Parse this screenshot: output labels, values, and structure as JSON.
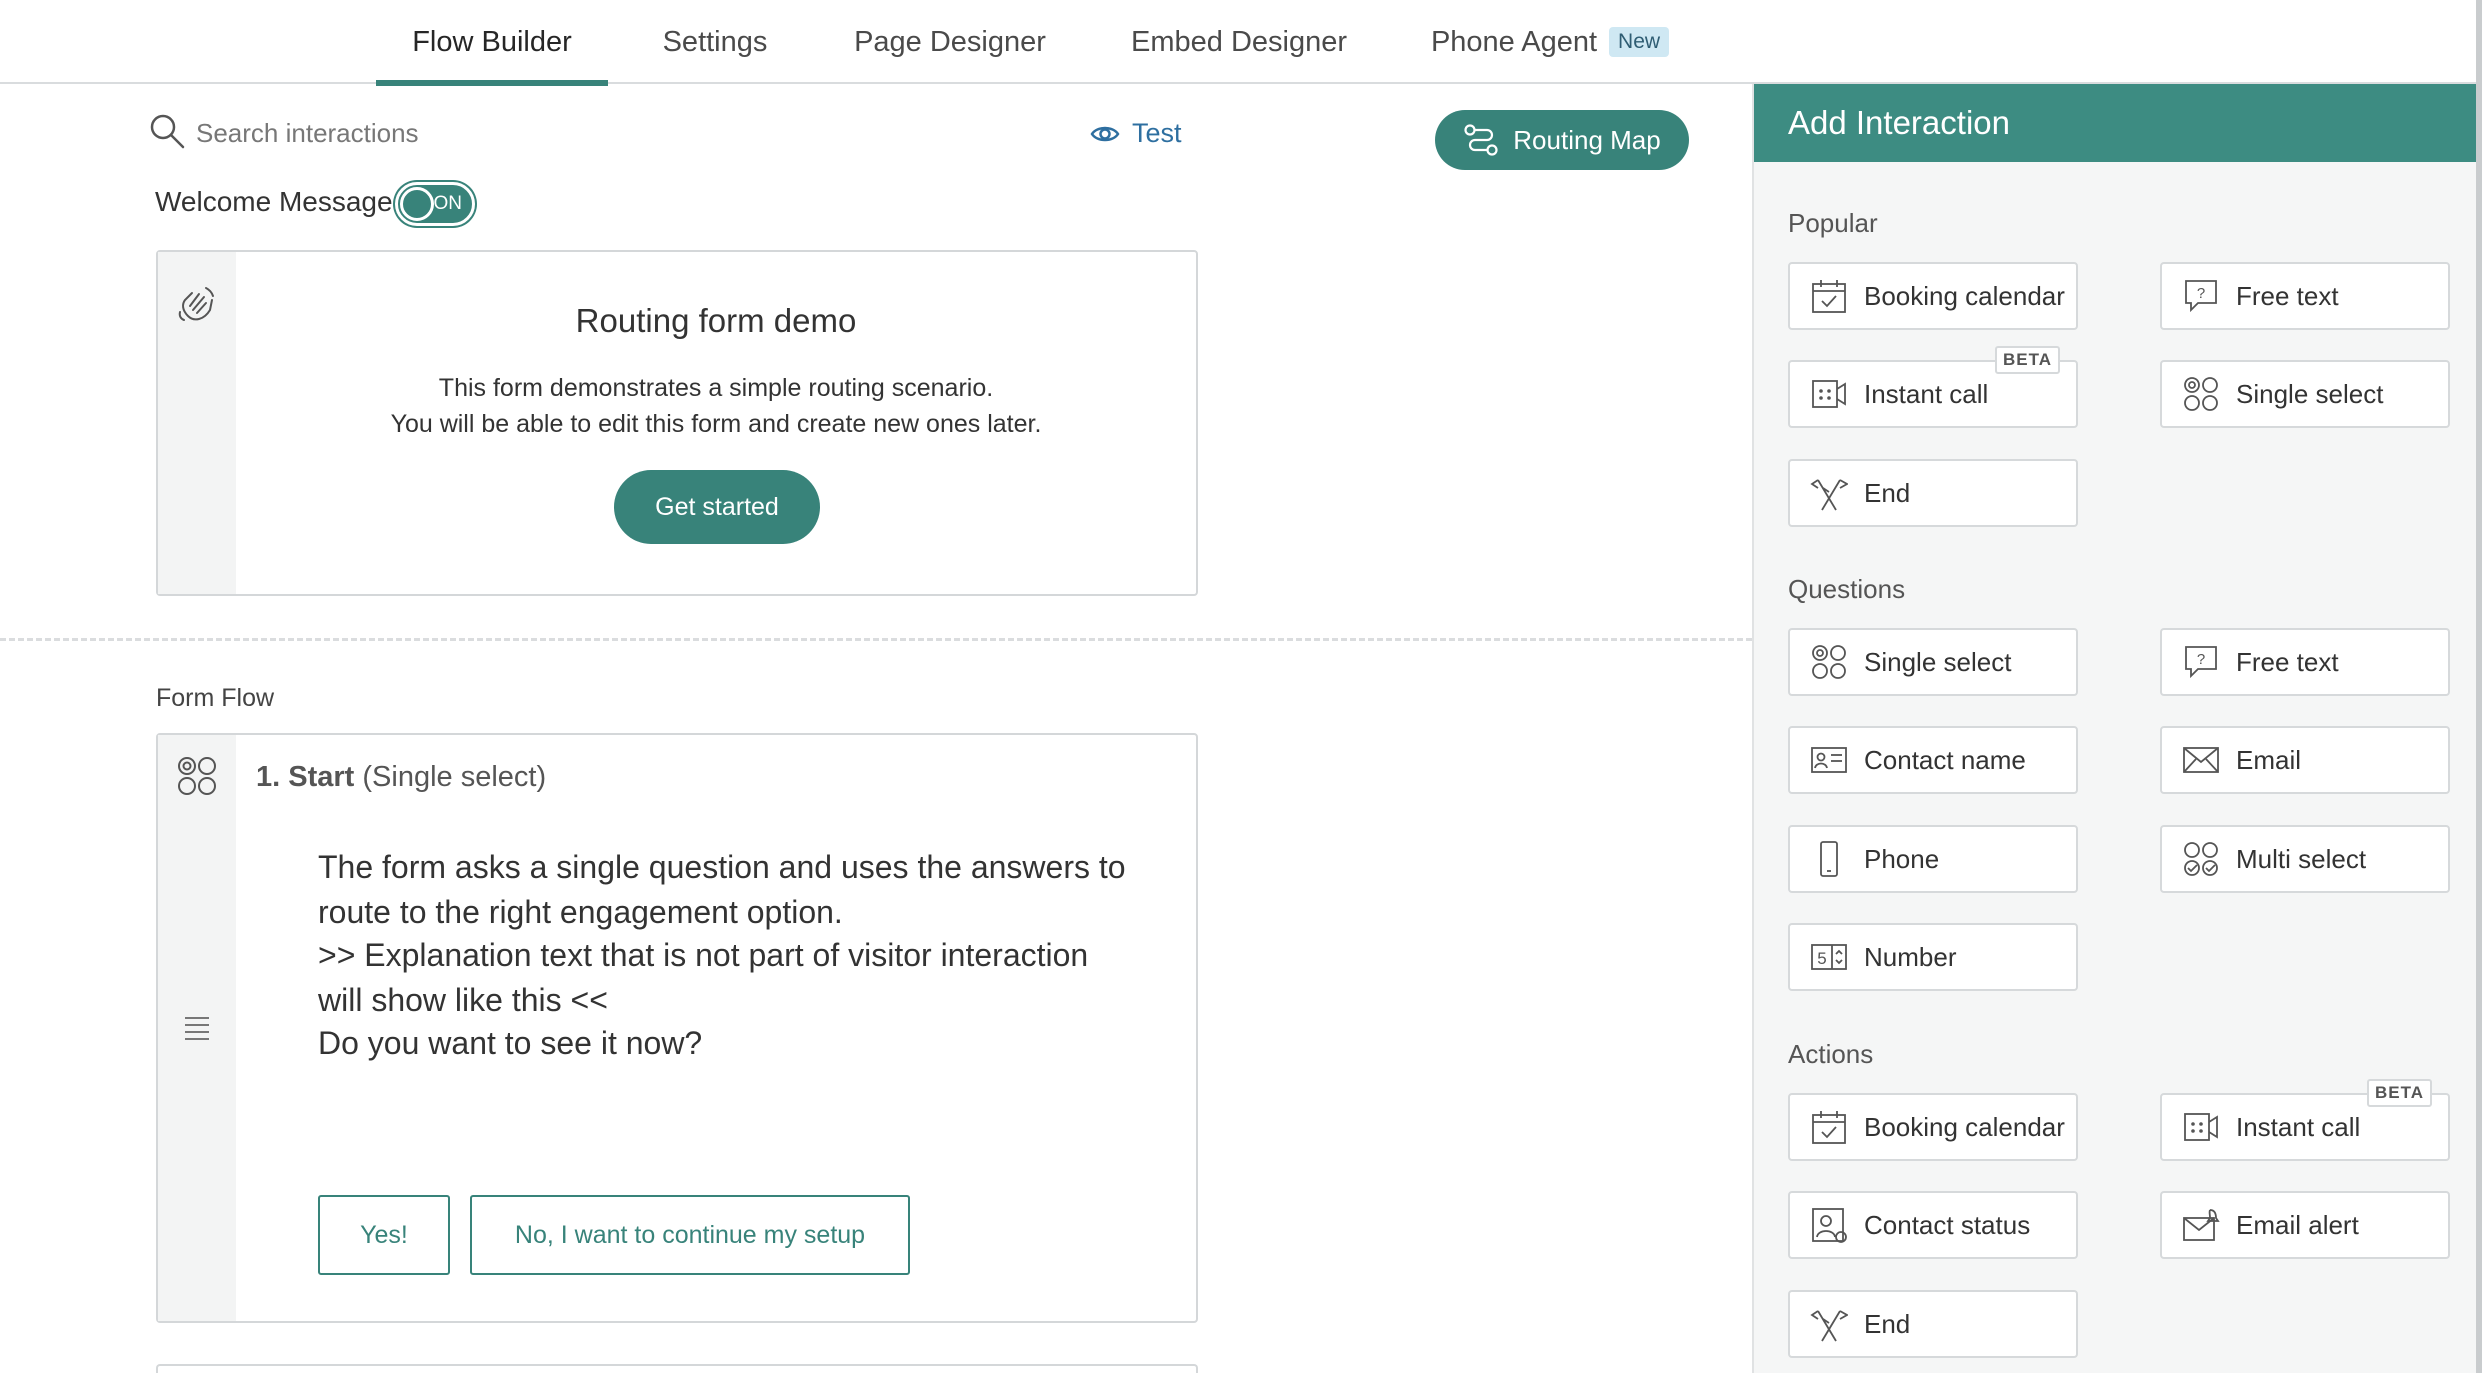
{
  "tabs": [
    {
      "label": "Flow Builder",
      "active": true
    },
    {
      "label": "Settings"
    },
    {
      "label": "Page Designer"
    },
    {
      "label": "Embed Designer"
    },
    {
      "label": "Phone Agent",
      "badge": "New"
    }
  ],
  "toolbar": {
    "search_placeholder": "Search interactions",
    "test_label": "Test",
    "routing_map_label": "Routing Map"
  },
  "welcome": {
    "label": "Welcome Message",
    "toggle": "ON",
    "title": "Routing form demo",
    "line1": "This form demonstrates a simple routing scenario.",
    "line2": "You will be able to edit this form and create new ones later.",
    "button": "Get started"
  },
  "flow": {
    "section_label": "Form Flow",
    "step_title": "1. Start",
    "step_type": "(Single select)",
    "paragraph1": "The form asks a single question and uses the answers to route to the right engagement option.",
    "paragraph2": ">> Explanation text that is not part of visitor interaction will show like this <<",
    "question": "Do you want to see it now?",
    "answers": [
      "Yes!",
      "No, I want to continue my setup"
    ]
  },
  "panel": {
    "title": "Add Interaction",
    "beta_label": "BETA",
    "sections": [
      {
        "title": "Popular",
        "items": [
          {
            "label": "Booking calendar",
            "icon": "calendar-icon"
          },
          {
            "label": "Free text",
            "icon": "question-bubble-icon"
          },
          {
            "label": "Instant call",
            "icon": "video-call-icon",
            "beta": true
          },
          {
            "label": "Single select",
            "icon": "single-select-icon"
          },
          {
            "label": "End",
            "icon": "flags-icon"
          }
        ]
      },
      {
        "title": "Questions",
        "items": [
          {
            "label": "Single select",
            "icon": "single-select-icon"
          },
          {
            "label": "Free text",
            "icon": "question-bubble-icon"
          },
          {
            "label": "Contact name",
            "icon": "id-card-icon"
          },
          {
            "label": "Email",
            "icon": "envelope-icon"
          },
          {
            "label": "Phone",
            "icon": "phone-icon"
          },
          {
            "label": "Multi select",
            "icon": "multi-select-icon"
          },
          {
            "label": "Number",
            "icon": "number-stepper-icon"
          }
        ]
      },
      {
        "title": "Actions",
        "items": [
          {
            "label": "Booking calendar",
            "icon": "calendar-icon"
          },
          {
            "label": "Instant call",
            "icon": "video-call-icon",
            "beta": true
          },
          {
            "label": "Contact status",
            "icon": "contact-status-icon"
          },
          {
            "label": "Email alert",
            "icon": "email-alert-icon"
          },
          {
            "label": "End",
            "icon": "flags-icon"
          }
        ]
      }
    ]
  },
  "colors": {
    "accent": "#38837a",
    "panel_header": "#3d8c82",
    "link": "#2e6fa0"
  }
}
